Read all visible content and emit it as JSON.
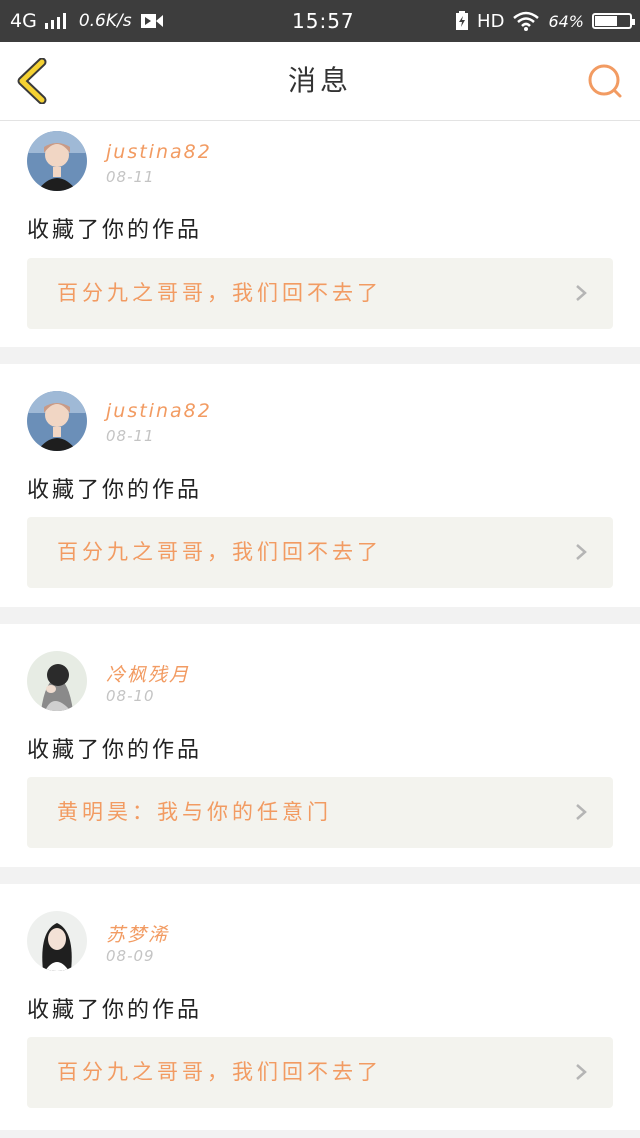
{
  "status_bar": {
    "network": "4G",
    "speed": "0.6K/s",
    "time": "15:57",
    "hd": "HD",
    "battery_text": "64%",
    "battery_level": 0.64
  },
  "header": {
    "title": "消息"
  },
  "colors": {
    "accent": "#f29b62",
    "back_arrow": "#f5d233"
  },
  "notifications": [
    {
      "username": "justina82",
      "date": "08-11",
      "action": "收藏了你的作品",
      "work_title": "百分九之哥哥，我们回不去了"
    },
    {
      "username": "justina82",
      "date": "08-11",
      "action": "收藏了你的作品",
      "work_title": "百分九之哥哥，我们回不去了"
    },
    {
      "username": "冷枫残月",
      "date": "08-10",
      "action": "收藏了你的作品",
      "work_title": "黄明昊：我与你的任意门"
    },
    {
      "username": "苏梦浠",
      "date": "08-09",
      "action": "收藏了你的作品",
      "work_title": "百分九之哥哥，我们回不去了"
    }
  ]
}
